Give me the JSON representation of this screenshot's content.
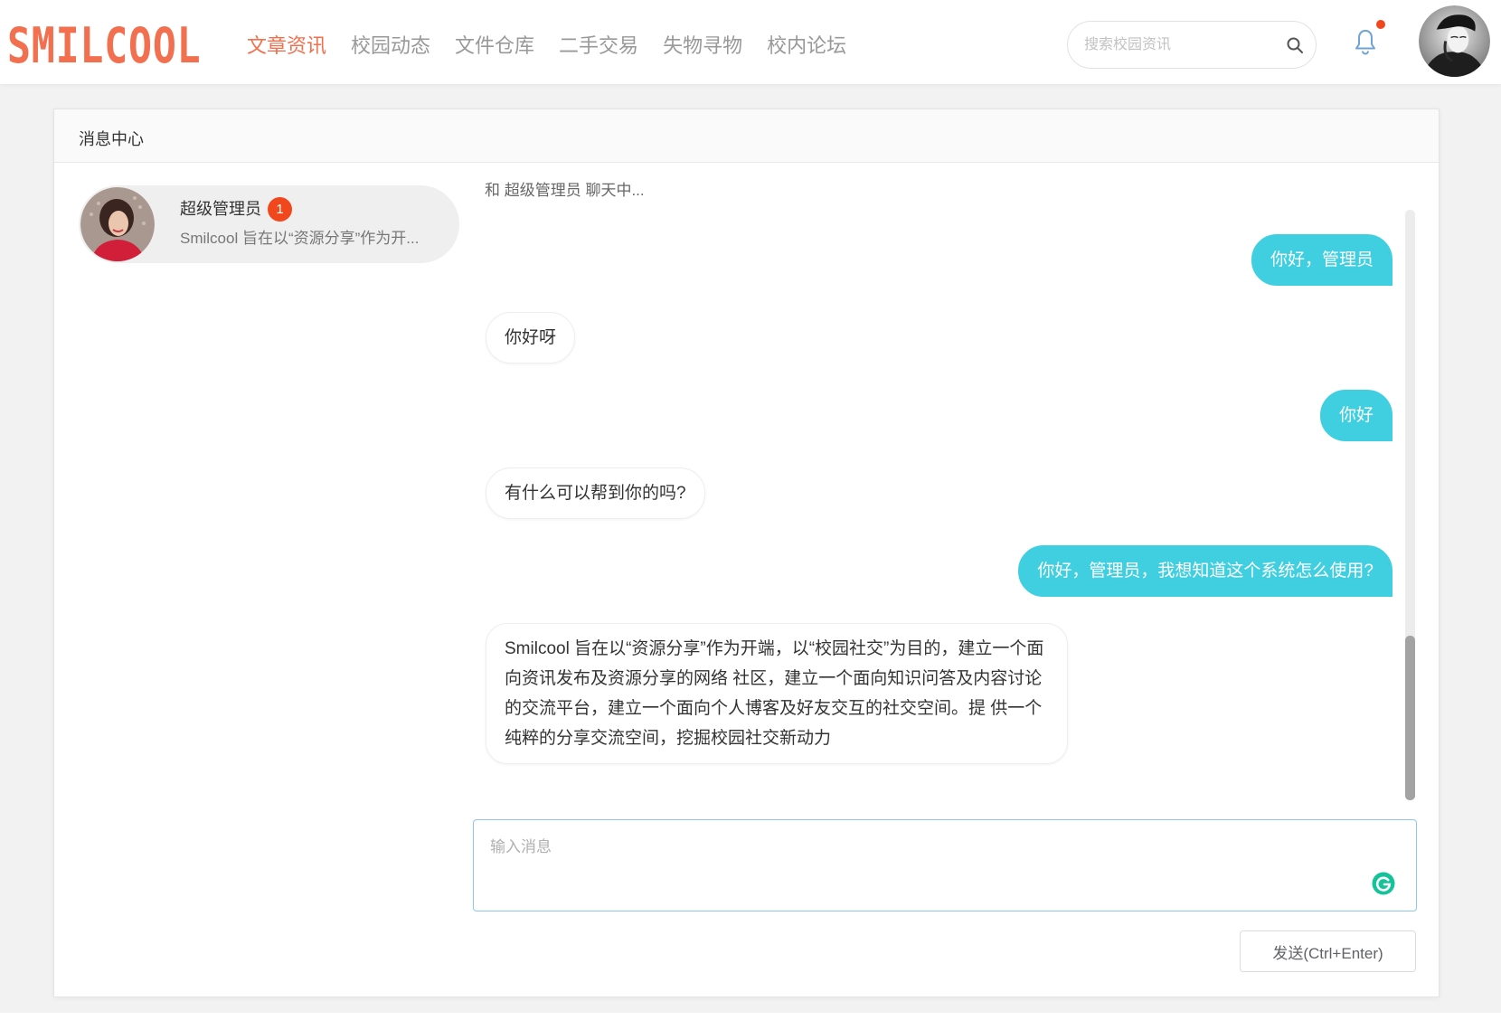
{
  "header": {
    "logo": "SMILCOOL",
    "nav": [
      {
        "label": "文章资讯",
        "active": true
      },
      {
        "label": "校园动态",
        "active": false
      },
      {
        "label": "文件仓库",
        "active": false
      },
      {
        "label": "二手交易",
        "active": false
      },
      {
        "label": "失物寻物",
        "active": false
      },
      {
        "label": "校内论坛",
        "active": false
      }
    ],
    "search": {
      "placeholder": "搜索校园资讯"
    },
    "notifications": {
      "has_unread": true
    }
  },
  "message_center": {
    "title": "消息中心",
    "contacts": [
      {
        "name": "超级管理员",
        "unread_count": 1,
        "preview": "Smilcool 旨在以“资源分享”作为开...",
        "selected": true
      }
    ],
    "chat": {
      "status": "和 超级管理员 聊天中...",
      "messages": [
        {
          "sent": true,
          "text": "你好，管理员"
        },
        {
          "sent": false,
          "text": "你好呀"
        },
        {
          "sent": true,
          "text": "你好"
        },
        {
          "sent": false,
          "text": "有什么可以帮到你的吗?"
        },
        {
          "sent": true,
          "text": "你好，管理员，我想知道这个系统怎么使用?"
        },
        {
          "sent": false,
          "lines": [
            "Smilcool 旨在以“资源分享”作为开端，以“校园社交”为目的，建立一个面",
            "向资讯发布及资源分享的网络 社区，建立一个面向知识问答及内容讨论",
            "的交流平台，建立一个面向个人博客及好友交互的社交空间。提 供一个",
            "纯粹的分享交流空间，挖掘校园社交新动力"
          ]
        }
      ],
      "input": {
        "placeholder": "输入消息"
      },
      "send_button": {
        "label": "发送(Ctrl+Enter)"
      }
    }
  },
  "icons": {
    "search": "search-icon",
    "notifications": "bell-icon",
    "extension": "grammarly-icon"
  },
  "colors": {
    "brand": "#f2704f",
    "sent_bubble": "#40cfe0",
    "badge": "#f0471c",
    "input_focus": "#8fc7ea",
    "bell": "#6ea3d4",
    "grammarly": "#15c39a"
  }
}
